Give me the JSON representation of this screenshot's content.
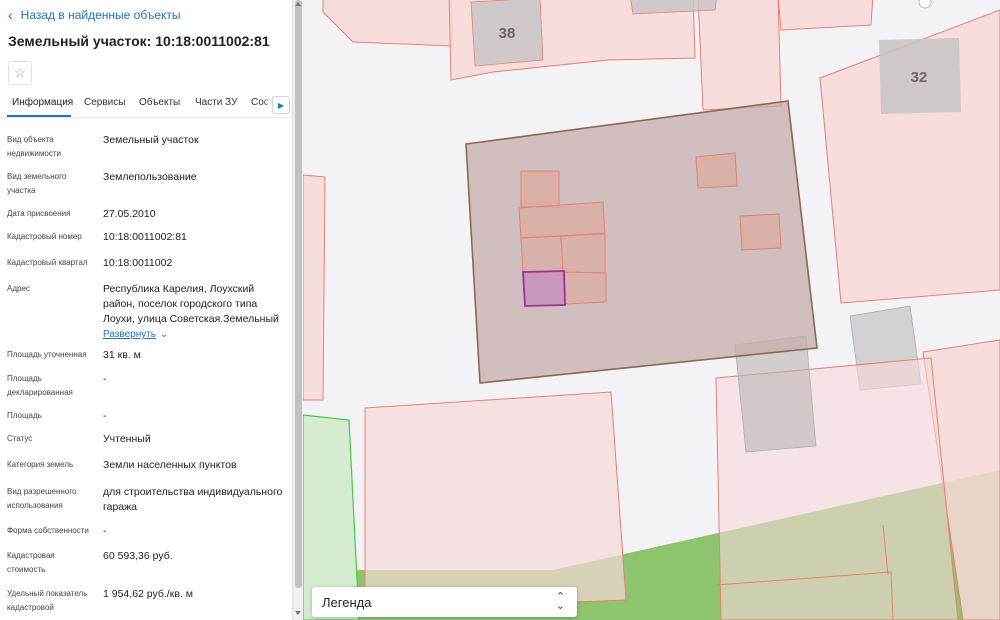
{
  "sidebar": {
    "back_label": "Назад в найденные объекты",
    "title": "Земельный участок: 10:18:0011002:81",
    "tabs": [
      {
        "label": "Информация",
        "active": true
      },
      {
        "label": "Сервисы"
      },
      {
        "label": "Объекты"
      },
      {
        "label": "Части ЗУ"
      },
      {
        "label": "Состав"
      }
    ],
    "fields": [
      {
        "label": "Вид объекта недвижимости",
        "value": "Земельный участок"
      },
      {
        "label": "Вид земельного участка",
        "value": "Землепользование"
      },
      {
        "label": "Дата присвоения",
        "value": "27.05.2010"
      },
      {
        "label": "Кадастровый номер",
        "value": "10:18:0011002:81"
      },
      {
        "label": "Кадастровый квартал",
        "value": "10:18:0011002"
      },
      {
        "label": "Адрес",
        "value": "Республика Карелия, Лоухский район, поселок городского типа Лоухи, улица Советская.Земельный",
        "expand": "Развернуть"
      },
      {
        "label": "Площадь уточненная",
        "value": "31 кв. м"
      },
      {
        "label": "Площадь декларированная",
        "value": "-"
      },
      {
        "label": "Площадь",
        "value": "-"
      },
      {
        "label": "Статус",
        "value": "Учтенный"
      },
      {
        "label": "Категория земель",
        "value": "Земли населенных пунктов"
      },
      {
        "label": "Вид разрешенного использования",
        "value": "для строительства индивидуального гаража"
      },
      {
        "label": "Форма собственности",
        "value": "-"
      },
      {
        "label": "Кадастровая стоимость",
        "value": "60 593,36 руб."
      },
      {
        "label": "Удельный показатель кадастровой",
        "value": "1 954,62 руб./кв. м"
      }
    ]
  },
  "map": {
    "building_labels": [
      "38",
      "32"
    ],
    "legend_label": "Легенда",
    "colors": {
      "parcel_outline": "#e8806e",
      "parcel_fill": "#f7d9d8",
      "selected_block": "#8b6a52",
      "selected_parcel": "#a0309a",
      "building": "#c9c5c5",
      "green_zone": "#8fc46f"
    }
  }
}
